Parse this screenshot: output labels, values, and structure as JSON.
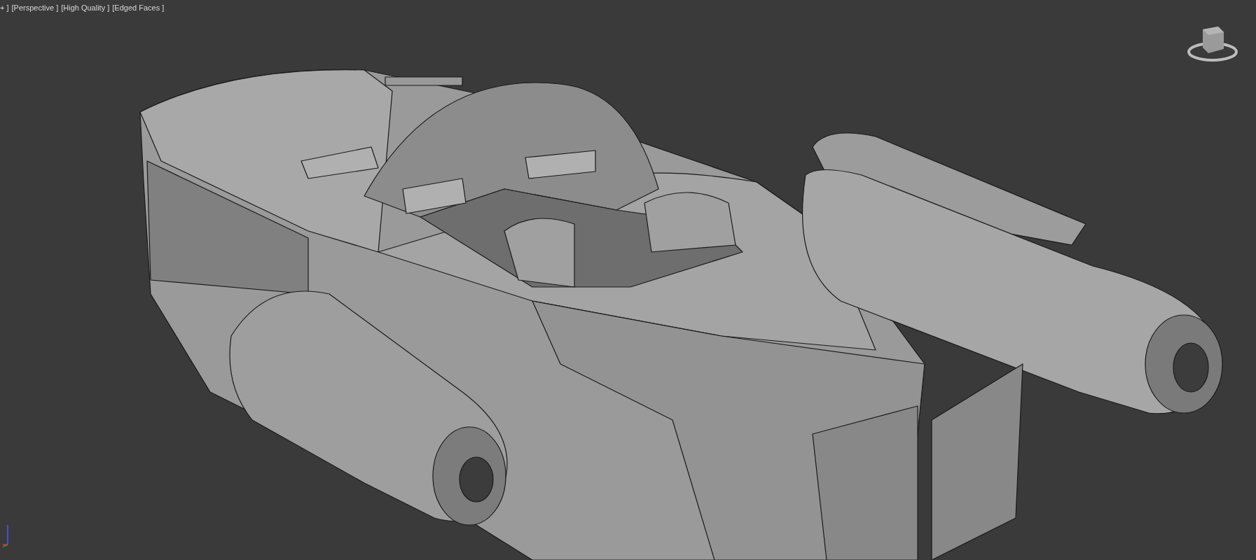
{
  "viewport": {
    "labels": [
      {
        "text": "+ ]"
      },
      {
        "text": "[Perspective ]"
      },
      {
        "text": "[High Quality ]"
      },
      {
        "text": "[Edged Faces ]"
      }
    ]
  }
}
